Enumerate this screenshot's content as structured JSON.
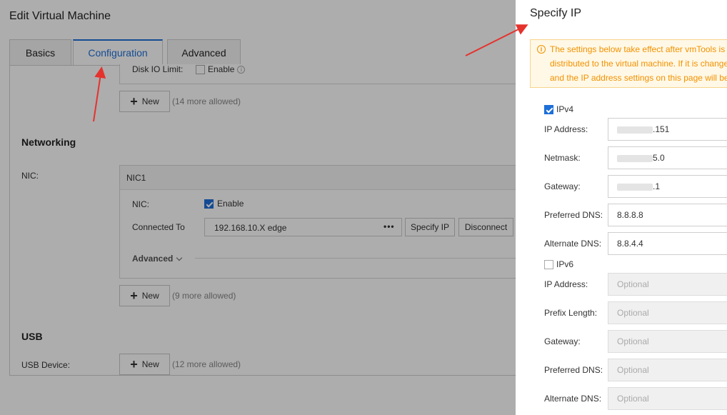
{
  "editor": {
    "title": "Edit Virtual Machine",
    "tabs": [
      "Basics",
      "Configuration",
      "Advanced"
    ],
    "disk_io": {
      "label": "Disk IO Limit:",
      "enable_label": "Enable"
    },
    "disk_new": {
      "label": "New",
      "allowed": "(14 more allowed)"
    },
    "networking": {
      "title": "Networking",
      "nic_label": "NIC:",
      "nic_card_title": "NIC1",
      "nic_enable_label": "NIC:",
      "enable_text": "Enable",
      "connected_to_label": "Connected To",
      "connected_to_value": "192.168.10.X edge",
      "more_icon": "•••",
      "specify_ip_button": "Specify IP",
      "disconnect_button": "Disconnect",
      "advanced_label": "Advanced",
      "new_label": "New",
      "new_allowed": "(9 more allowed)"
    },
    "usb": {
      "title": "USB",
      "device_label": "USB Device:",
      "new_label": "New",
      "new_allowed": "(12 more allowed)"
    }
  },
  "drawer": {
    "title": "Specify IP",
    "notice_lines": [
      "The settings below take effect after vmTools is",
      "distributed to the virtual machine. If it is change",
      "and the IP address settings on this page will be"
    ],
    "ipv4": {
      "label": "IPv4",
      "checked": true,
      "fields": [
        {
          "label": "IP Address:",
          "value": ".151"
        },
        {
          "label": "Netmask:",
          "value": "5.0"
        },
        {
          "label": "Gateway:",
          "value": ".1"
        },
        {
          "label": "Preferred DNS:",
          "value": "8.8.8.8"
        },
        {
          "label": "Alternate DNS:",
          "value": "8.8.4.4"
        }
      ]
    },
    "ipv6": {
      "label": "IPv6",
      "checked": false,
      "fields": [
        {
          "label": "IP Address:",
          "placeholder": "Optional"
        },
        {
          "label": "Prefix Length:",
          "placeholder": "Optional"
        },
        {
          "label": "Gateway:",
          "placeholder": "Optional"
        },
        {
          "label": "Preferred DNS:",
          "placeholder": "Optional"
        },
        {
          "label": "Alternate DNS:",
          "placeholder": "Optional"
        }
      ]
    }
  },
  "colors": {
    "accent": "#1e6fd9",
    "warning": "#f29100",
    "annotation_arrow": "#e5322d"
  }
}
